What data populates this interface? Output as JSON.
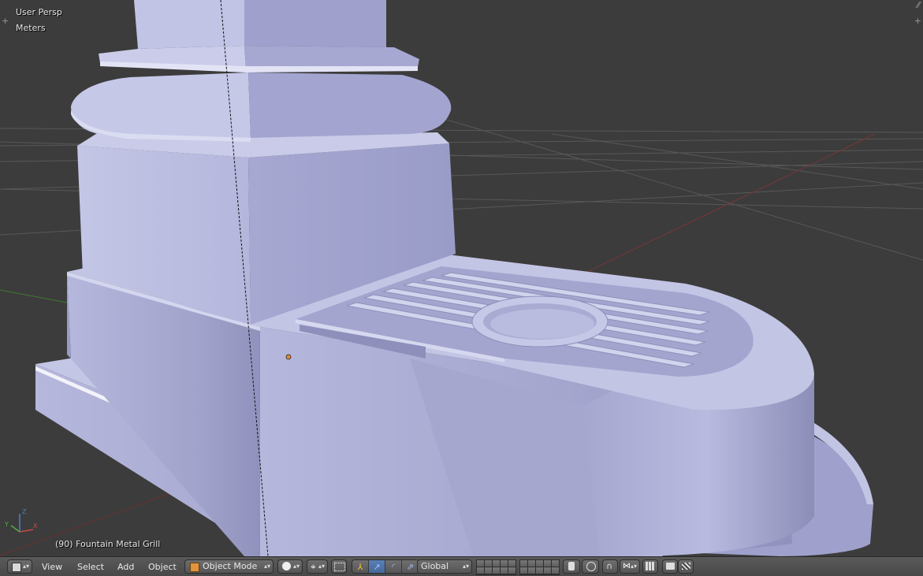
{
  "viewport": {
    "view_name": "User Persp",
    "units": "Meters",
    "object_info": "(90) Fountain Metal Grill",
    "axes": {
      "x_label": "X",
      "y_label": "Y",
      "z_label": "Z"
    },
    "colors": {
      "background": "#3c3c3c",
      "grid": "#5a5a5a",
      "x_axis": "#8a3a3a",
      "y_axis": "#4e8a3e",
      "mesh_light": "#c6c8e6",
      "mesh_mid": "#a9abd0",
      "mesh_dark": "#8d8fb8",
      "origin": "#e08a3a"
    }
  },
  "header": {
    "editor_type_icon": "cube-icon",
    "menus": [
      "View",
      "Select",
      "Add",
      "Object"
    ],
    "mode": {
      "icon": "object-mode-icon",
      "label": "Object Mode"
    },
    "shading_icon": "solid-sphere-icon",
    "pivot_icon": "pivot-point-icon",
    "orientation": "Global",
    "accent": "#5a7fb5"
  }
}
